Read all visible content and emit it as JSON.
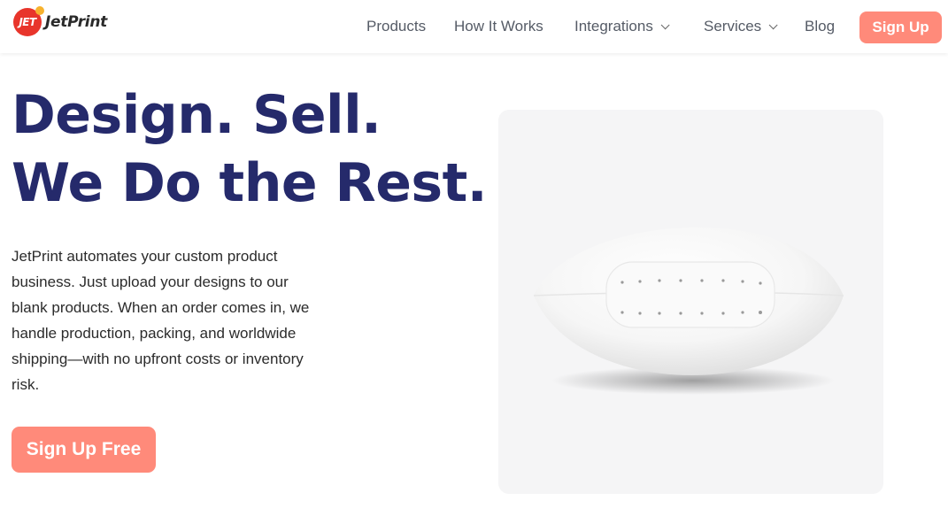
{
  "brand": {
    "badge_text": "JET",
    "name": "JetPrint",
    "accent": "#ff8a7a",
    "logo_red": "#e8352b",
    "logo_yellow": "#f7b22e"
  },
  "nav": {
    "items": [
      {
        "label": "Products",
        "has_dropdown": false
      },
      {
        "label": "How It Works",
        "has_dropdown": false
      },
      {
        "label": "Integrations",
        "has_dropdown": true
      },
      {
        "label": "Services",
        "has_dropdown": true
      },
      {
        "label": "Blog",
        "has_dropdown": false
      }
    ],
    "signup_label": "Sign Up"
  },
  "hero": {
    "title_line1": "Design. Sell.",
    "title_line2": "We Do the Rest.",
    "title_color": "#252a6b",
    "description": "JetPrint automates your custom product business. Just upload your designs to our blank products. When an order comes in, we handle production, packing, and worldwide shipping—with no upfront costs or inventory risk.",
    "cta_label": "Sign Up Free"
  },
  "product_image": {
    "icon": "white-american-football",
    "background": "#f5f5f6"
  }
}
